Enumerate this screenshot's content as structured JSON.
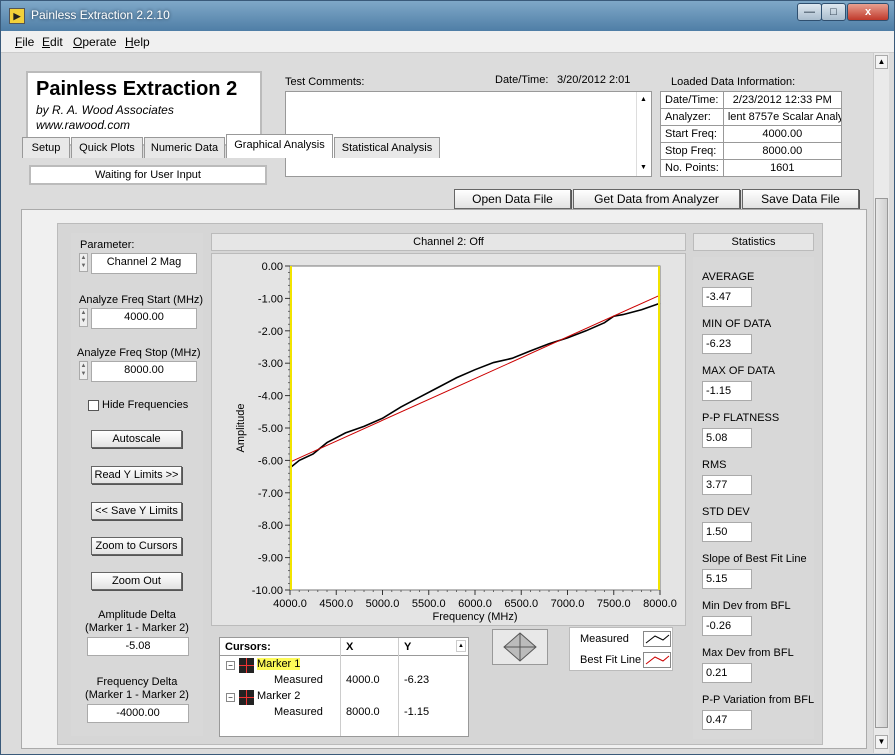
{
  "window": {
    "title": "Painless Extraction 2.2.10",
    "minimize": "—",
    "restore": "□",
    "close": "x"
  },
  "menu": [
    {
      "label": "File",
      "key": "F",
      "rest": "ile"
    },
    {
      "label": "Edit",
      "key": "E",
      "rest": "dit"
    },
    {
      "label": "Operate",
      "key": "O",
      "rest": "perate"
    },
    {
      "label": "Help",
      "key": "H",
      "rest": "elp"
    }
  ],
  "brand": {
    "title": "Painless Extraction 2",
    "author": "by R. A. Wood Associates",
    "url": "www.rawood.com"
  },
  "status": "Waiting for User Input",
  "comments": {
    "label": "Test Comments:",
    "value": ""
  },
  "datetime": {
    "label": "Date/Time:",
    "value": "3/20/2012  2:01"
  },
  "loaded": {
    "title": "Loaded Data Information:",
    "rows": [
      {
        "k": "Date/Time:",
        "v": "2/23/2012 12:33 PM"
      },
      {
        "k": "Analyzer:",
        "v": "lent 8757e Scalar Analyz"
      },
      {
        "k": "Start Freq:",
        "v": "4000.00"
      },
      {
        "k": "Stop Freq:",
        "v": "8000.00"
      },
      {
        "k": "No. Points:",
        "v": "1601"
      }
    ]
  },
  "tabs": [
    "Setup",
    "Quick Plots",
    "Numeric Data",
    "Graphical Analysis",
    "Statistical Analysis"
  ],
  "actions": {
    "open": "Open Data File",
    "get": "Get Data from Analyzer",
    "save": "Save Data File"
  },
  "left": {
    "param_label": "Parameter:",
    "param_value": "Channel 2 Mag",
    "start_label": "Analyze Freq Start (MHz)",
    "start_value": "4000.00",
    "stop_label": "Analyze Freq Stop (MHz)",
    "stop_value": "8000.00",
    "hide_label": "Hide Frequencies",
    "autoscale": "Autoscale",
    "read_y": "Read Y Limits >>",
    "save_y": "<< Save Y Limits",
    "zoom_cursors": "Zoom to Cursors",
    "zoom_out": "Zoom Out",
    "amp_delta_label1": "Amplitude Delta",
    "amp_delta_label2": "(Marker 1 - Marker 2)",
    "amp_delta_value": "-5.08",
    "freq_delta_label1": "Frequency Delta",
    "freq_delta_label2": "(Marker 1 - Marker 2)",
    "freq_delta_value": "-4000.00"
  },
  "chart_header": "Channel 2: Off",
  "chart_data": {
    "type": "line",
    "title": "",
    "xlabel": "Frequency (MHz)",
    "ylabel": "Amplitude",
    "xlim": [
      4000,
      8000
    ],
    "ylim": [
      -10,
      0
    ],
    "xticks": [
      "4000.0",
      "4500.0",
      "5000.0",
      "5500.0",
      "6000.0",
      "6500.0",
      "7000.0",
      "7500.0",
      "8000.0"
    ],
    "yticks": [
      "0.00",
      "-1.00",
      "-2.00",
      "-3.00",
      "-4.00",
      "-5.00",
      "-6.00",
      "-7.00",
      "-8.00",
      "-9.00",
      "-10.00"
    ],
    "grid": false,
    "series": [
      {
        "name": "Measured",
        "color": "#000000",
        "x": [
          4000,
          4100,
          4250,
          4400,
          4600,
          4800,
          5000,
          5200,
          5400,
          5600,
          5800,
          6000,
          6200,
          6400,
          6600,
          6800,
          7000,
          7200,
          7400,
          7500,
          7600,
          7800,
          8000
        ],
        "y": [
          -6.23,
          -6.0,
          -5.8,
          -5.45,
          -5.15,
          -4.95,
          -4.7,
          -4.35,
          -4.05,
          -3.75,
          -3.45,
          -3.2,
          -2.98,
          -2.85,
          -2.62,
          -2.4,
          -2.22,
          -2.0,
          -1.75,
          -1.55,
          -1.5,
          -1.35,
          -1.15
        ]
      },
      {
        "name": "Best Fit Line",
        "color": "#cc0000",
        "x": [
          4000,
          8000
        ],
        "y": [
          -6.05,
          -0.9
        ]
      }
    ]
  },
  "cursors": {
    "headers": [
      "Cursors:",
      "X",
      "Y"
    ],
    "rows": [
      {
        "name": "Marker 1",
        "sub": "Measured",
        "x": "4000.0",
        "y": "-6.23"
      },
      {
        "name": "Marker 2",
        "sub": "Measured",
        "x": "8000.0",
        "y": "-1.15"
      }
    ]
  },
  "legend": [
    {
      "name": "Measured",
      "color": "#000000"
    },
    {
      "name": "Best Fit Line",
      "color": "#cc0000"
    }
  ],
  "stats": {
    "title": "Statistics",
    "items": [
      {
        "k": "AVERAGE",
        "v": "-3.47"
      },
      {
        "k": "MIN OF DATA",
        "v": "-6.23"
      },
      {
        "k": "MAX OF DATA",
        "v": "-1.15"
      },
      {
        "k": "P-P FLATNESS",
        "v": "5.08"
      },
      {
        "k": "RMS",
        "v": "3.77"
      },
      {
        "k": "STD DEV",
        "v": "1.50"
      },
      {
        "k": "Slope of Best Fit Line",
        "v": "5.15"
      },
      {
        "k": "Min Dev from BFL",
        "v": "-0.26"
      },
      {
        "k": "Max Dev from BFL",
        "v": "0.21"
      },
      {
        "k": "P-P Variation from BFL",
        "v": "0.47"
      }
    ]
  }
}
